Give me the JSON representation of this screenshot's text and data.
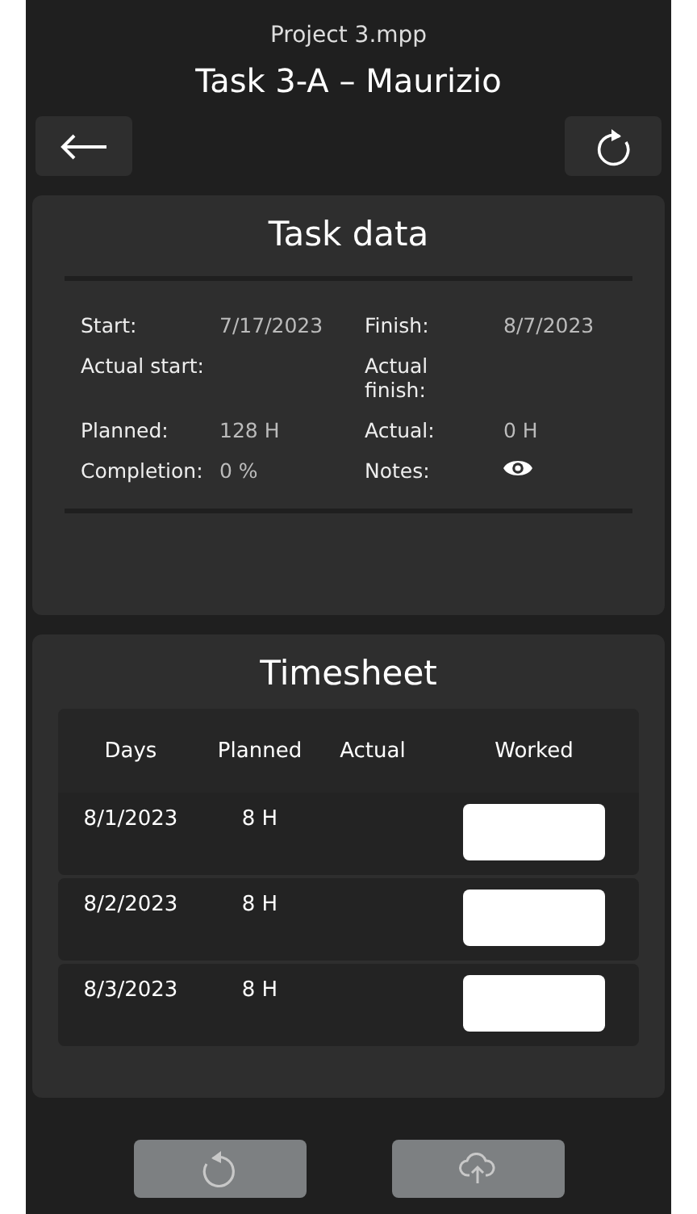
{
  "header": {
    "file": "Project 3.mpp",
    "title": "Task 3-A – Maurizio"
  },
  "task_data": {
    "title": "Task data",
    "fields": [
      {
        "label": "Start:",
        "value": "7/17/2023",
        "kind": "text"
      },
      {
        "label": "Finish:",
        "value": "8/7/2023",
        "kind": "text"
      },
      {
        "label": "Actual start:",
        "kind": "text"
      },
      {
        "label": "Actual finish:",
        "kind": "text"
      },
      {
        "label": "Planned:",
        "value": "128 H",
        "kind": "text"
      },
      {
        "label": "Actual:",
        "value": "0 H",
        "kind": "text"
      },
      {
        "label": "Completion:",
        "value": "0 %",
        "kind": "text"
      },
      {
        "label": "Notes:",
        "kind": "eye"
      }
    ]
  },
  "timesheet": {
    "title": "Timesheet",
    "columns": [
      "Days",
      "Planned",
      "Actual",
      "Worked"
    ],
    "rows": [
      {
        "day": "8/1/2023",
        "planned": "8 H"
      },
      {
        "day": "8/2/2023",
        "planned": "8 H"
      },
      {
        "day": "8/3/2023",
        "planned": "8 H"
      }
    ]
  },
  "footer_buttons": [
    {
      "kind": "undo",
      "disabled": true
    },
    {
      "kind": "upload",
      "disabled": true
    }
  ]
}
